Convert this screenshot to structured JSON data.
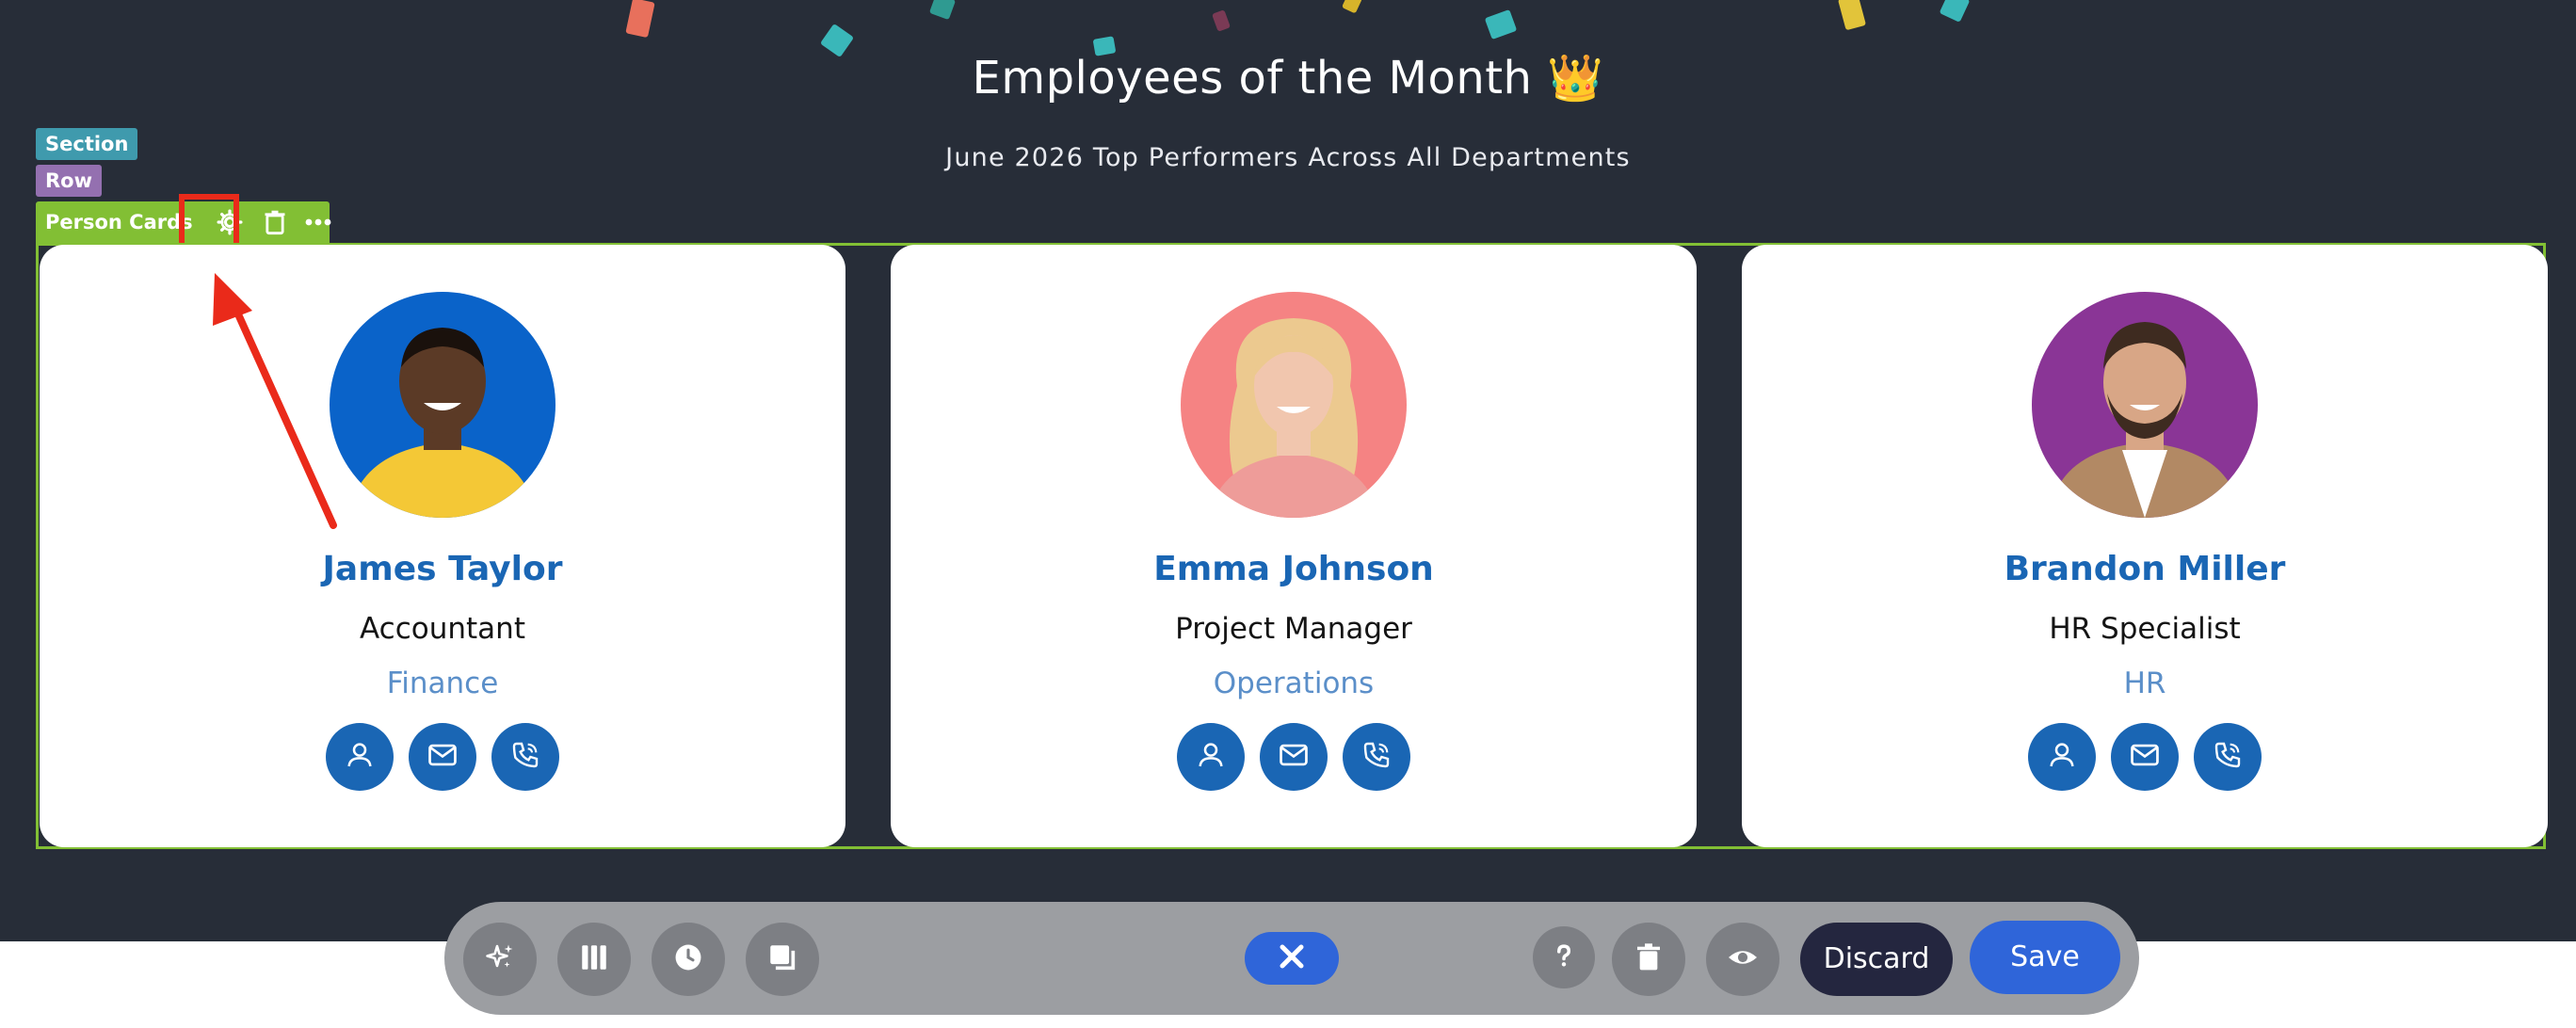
{
  "hero": {
    "title": "Employees of the Month 👑",
    "subtitle": "June 2026 Top Performers Across All Departments"
  },
  "editor": {
    "section_tag": "Section",
    "row_tag": "Row",
    "element_tag": "Person Cards"
  },
  "cards": [
    {
      "name": "James Taylor",
      "role": "Accountant",
      "department": "Finance",
      "avatar_bg": "#0a63c9",
      "shirt_color": "#f4c836",
      "skin": "#5b3a26",
      "hair": "#1a110c"
    },
    {
      "name": "Emma Johnson",
      "role": "Project Manager",
      "department": "Operations",
      "avatar_bg": "#f58383",
      "shirt_color": "#ee9c99",
      "skin": "#f1c6ae",
      "hair": "#ecc98f"
    },
    {
      "name": "Brandon Miller",
      "role": "HR Specialist",
      "department": "HR",
      "avatar_bg": "#8a3596",
      "shirt_color": "#b28964",
      "skin": "#d8a686",
      "hair": "#3e2b20"
    }
  ],
  "bottom_bar": {
    "discard_label": "Discard",
    "save_label": "Save"
  },
  "colors": {
    "hero_bg": "#272d38",
    "accent_green": "#82bf34",
    "name_blue": "#1a66b4",
    "primary_blue": "#2f65d9",
    "highlight_red": "#ea2a1a"
  },
  "icons": [
    "crown-emoji",
    "gear-icon",
    "trash-icon",
    "more-icon",
    "user-icon",
    "mail-icon",
    "phone-icon",
    "sparkle-icon",
    "columns-icon",
    "history-icon",
    "layers-icon",
    "close-icon",
    "help-icon",
    "delete-icon",
    "eye-icon"
  ]
}
